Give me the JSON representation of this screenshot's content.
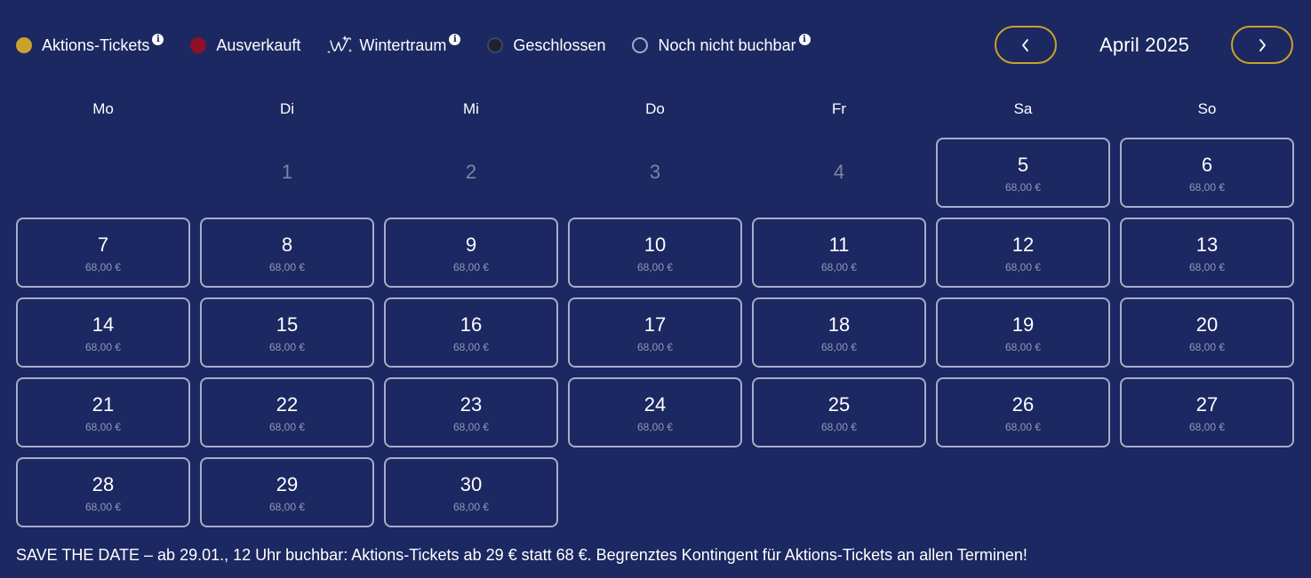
{
  "legend": {
    "aktions": "Aktions-Tickets",
    "ausverkauft": "Ausverkauft",
    "wintertraum": "Wintertraum",
    "geschlossen": "Geschlossen",
    "noch_nicht": "Noch nicht buchbar",
    "info_glyph": "i"
  },
  "colors": {
    "background": "#1c2861",
    "gold": "#c9a22c",
    "sold_out_red": "#8f1026",
    "cell_border": "#a7acc9"
  },
  "icons": {
    "prev": "chevron-left-icon",
    "next": "chevron-right-icon",
    "info": "info-icon",
    "wintertraum": "wintertraum-logo-icon"
  },
  "month": {
    "title": "April 2025"
  },
  "weekdays": [
    "Mo",
    "Di",
    "Mi",
    "Do",
    "Fr",
    "Sa",
    "So"
  ],
  "days": {
    "inactive": [
      "1",
      "2",
      "3",
      "4"
    ],
    "bookable": [
      {
        "day": "5",
        "price": "68,00 €"
      },
      {
        "day": "6",
        "price": "68,00 €"
      },
      {
        "day": "7",
        "price": "68,00 €"
      },
      {
        "day": "8",
        "price": "68,00 €"
      },
      {
        "day": "9",
        "price": "68,00 €"
      },
      {
        "day": "10",
        "price": "68,00 €"
      },
      {
        "day": "11",
        "price": "68,00 €"
      },
      {
        "day": "12",
        "price": "68,00 €"
      },
      {
        "day": "13",
        "price": "68,00 €"
      },
      {
        "day": "14",
        "price": "68,00 €"
      },
      {
        "day": "15",
        "price": "68,00 €"
      },
      {
        "day": "16",
        "price": "68,00 €"
      },
      {
        "day": "17",
        "price": "68,00 €"
      },
      {
        "day": "18",
        "price": "68,00 €"
      },
      {
        "day": "19",
        "price": "68,00 €"
      },
      {
        "day": "20",
        "price": "68,00 €"
      },
      {
        "day": "21",
        "price": "68,00 €"
      },
      {
        "day": "22",
        "price": "68,00 €"
      },
      {
        "day": "23",
        "price": "68,00 €"
      },
      {
        "day": "24",
        "price": "68,00 €"
      },
      {
        "day": "25",
        "price": "68,00 €"
      },
      {
        "day": "26",
        "price": "68,00 €"
      },
      {
        "day": "27",
        "price": "68,00 €"
      },
      {
        "day": "28",
        "price": "68,00 €"
      },
      {
        "day": "29",
        "price": "68,00 €"
      },
      {
        "day": "30",
        "price": "68,00 €"
      }
    ]
  },
  "note": "SAVE THE DATE – ab 29.01., 12 Uhr buchbar: Aktions-Tickets ab 29 € statt 68 €. Begrenztes Kontingent für Aktions-Tickets an allen Terminen!"
}
